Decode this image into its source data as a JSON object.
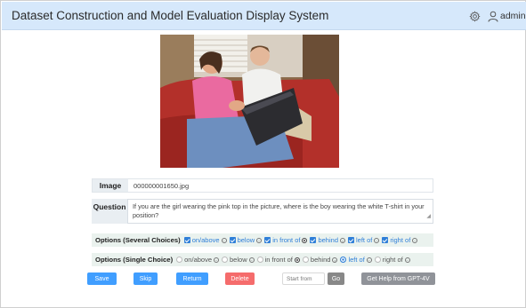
{
  "header": {
    "title": "Dataset Construction and Model Evaluation Display System",
    "user": "admin",
    "settings_icon": "gear-icon",
    "user_icon": "user-icon"
  },
  "image_row": {
    "label": "Image",
    "value": "000000001650.jpg"
  },
  "question_row": {
    "label": "Question",
    "value": "If you are the girl wearing the pink top in the picture, where is the boy wearing the white T-shirt in your position?"
  },
  "options_multi": {
    "label": "Options (Several Choices)",
    "items": [
      {
        "text": "on/above",
        "checked": true
      },
      {
        "text": "below",
        "checked": true
      },
      {
        "text": "in front of",
        "checked": true
      },
      {
        "text": "behind",
        "checked": true
      },
      {
        "text": "left of",
        "checked": true
      },
      {
        "text": "right of",
        "checked": true
      }
    ]
  },
  "options_single": {
    "label": "Options (Single Choice)",
    "selected": "left of",
    "items": [
      {
        "text": "on/above"
      },
      {
        "text": "below"
      },
      {
        "text": "in front of"
      },
      {
        "text": "behind"
      },
      {
        "text": "left of"
      },
      {
        "text": "right of"
      }
    ]
  },
  "actions": {
    "save": "Save",
    "skip": "Skip",
    "return": "Return",
    "delete": "Delete",
    "start_placeholder": "Start from",
    "go": "Go",
    "gpt": "Get Help from GPT-4V"
  },
  "colors": {
    "primary": "#409eff",
    "danger": "#f56c6c",
    "header_bg": "#d6e8fb",
    "options_bg": "#eaf2ee"
  }
}
